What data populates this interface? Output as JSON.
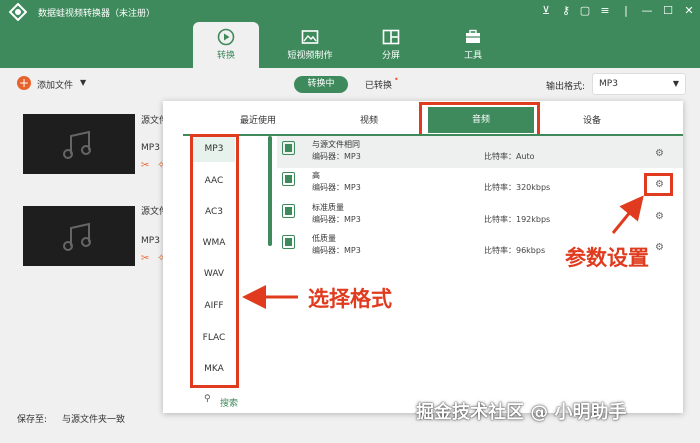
{
  "app": {
    "title": "数据蛙视频转换器（未注册）"
  },
  "nav": {
    "convert": "转换",
    "short_video": "短视频制作",
    "split_screen": "分屏",
    "tools": "工具"
  },
  "toolbar": {
    "add_file": "添加文件",
    "converting": "转换中",
    "converted": "已转换",
    "converted_dot": "•",
    "format_label": "输出格式:",
    "format_value": "MP3"
  },
  "files": [
    {
      "label": "源文件",
      "format": "MP3"
    },
    {
      "label": "源文件",
      "format": "MP3"
    }
  ],
  "bottom": {
    "save_label": "保存至:",
    "save_value": "与源文件夹一致"
  },
  "panel": {
    "tabs": [
      "最近使用",
      "视频",
      "音频",
      "设备"
    ],
    "formats": [
      "MP3",
      "AAC",
      "AC3",
      "WMA",
      "WAV",
      "AIFF",
      "FLAC",
      "MKA"
    ],
    "search": "搜索",
    "presets": [
      {
        "name": "与源文件相同",
        "encoder": "编码器：MP3",
        "bitrate": "比特率：Auto"
      },
      {
        "name": "高",
        "encoder": "编码器：MP3",
        "bitrate": "比特率：320kbps"
      },
      {
        "name": "标准质量",
        "encoder": "编码器：MP3",
        "bitrate": "比特率：192kbps"
      },
      {
        "name": "低质量",
        "encoder": "编码器：MP3",
        "bitrate": "比特率：96kbps"
      }
    ]
  },
  "annotations": {
    "param": "参数设置",
    "choose": "选择格式",
    "watermark": "掘金技术社区 @ 小明助手"
  },
  "colors": {
    "brand": "#3e8a5c",
    "annotation": "#e03b1e",
    "accent": "#e8632c"
  }
}
